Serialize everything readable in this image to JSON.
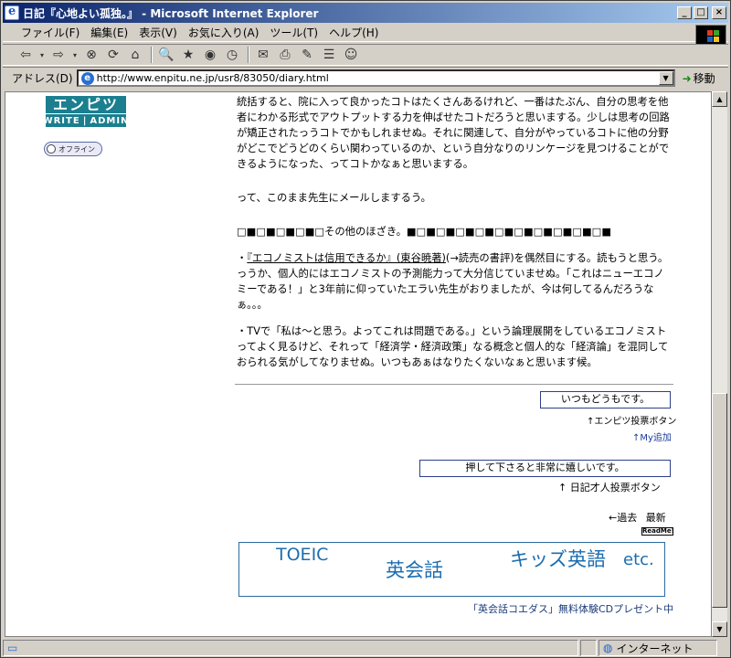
{
  "window": {
    "title": "日記『心地よい孤独。』 - Microsoft Internet Explorer",
    "controls": {
      "minimize": "_",
      "maximize": "□",
      "close": "×"
    }
  },
  "menu": [
    "ファイル(F)",
    "編集(E)",
    "表示(V)",
    "お気に入り(A)",
    "ツール(T)",
    "ヘルプ(H)"
  ],
  "toolbar": {
    "buttons": [
      {
        "icon": "back-icon",
        "glyph": "⇦"
      },
      {
        "icon": "dropdown-icon",
        "glyph": "▾"
      },
      {
        "icon": "forward-icon",
        "glyph": "⇨"
      },
      {
        "icon": "dropdown-icon",
        "glyph": "▾"
      },
      {
        "icon": "stop-icon",
        "glyph": "⊗"
      },
      {
        "icon": "refresh-icon",
        "glyph": "⟳"
      },
      {
        "icon": "home-icon",
        "glyph": "⌂"
      },
      {
        "icon": "search-icon",
        "glyph": "🔍"
      },
      {
        "icon": "favorites-icon",
        "glyph": "★"
      },
      {
        "icon": "media-icon",
        "glyph": "◉"
      },
      {
        "icon": "history-icon",
        "glyph": "◷"
      },
      {
        "icon": "mail-icon",
        "glyph": "✉"
      },
      {
        "icon": "print-icon",
        "glyph": "⎙"
      },
      {
        "icon": "edit-icon",
        "glyph": "✎"
      },
      {
        "icon": "discuss-icon",
        "glyph": "☰"
      },
      {
        "icon": "messenger-icon",
        "glyph": "☺"
      }
    ]
  },
  "address": {
    "label": "アドレス(D)",
    "url": "http://www.enpitu.ne.jp/usr8/83050/diary.html",
    "go_label": "移動"
  },
  "sidebar": {
    "logo_top": "エンピツ",
    "logo_write": "WRITE",
    "logo_sep": "|",
    "logo_admin": "ADMIN",
    "offline_label": "オフライン"
  },
  "article": {
    "para1": "統括すると、院に入って良かったコトはたくさんあるけれど、一番はたぶん、自分の思考を他者にわかる形式でアウトプットする力を伸ばせたコトだろうと思いまする。少しは思考の回路が矯正されたっうコトでかもしれませぬ。それに関連して、自分がやっているコトに他の分野がどこでどうどのくらい関わっているのか、という自分なりのリンケージを見つけることができるようになった、ってコトかなぁと思いまする。",
    "para2": "って、このまま先生にメールしまするう。",
    "para3": "□■□■□■□■□その他のほざき。■□■□■□■□■□■□■□■□■□■□■",
    "para4_prefix": "・",
    "para4_link": "『エコノミストは信用できるか』(東谷暁著)",
    "para4_rest": "(→読売の書評)を偶然目にする。読もうと思う。っうか、個人的にはエコノミストの予測能力って大分信じていませぬ。「これはニューエコノミーである！」と3年前に仰っていたエラい先生がおりましたが、今は何してるんだろうなぁ。。。",
    "para5": "・TVで「私は～と思う。よってこれは問題である。」という論理展開をしているエコノミストってよく見るけど、それって「経済学・経済政策」なる概念と個人的な「経済論」を混同しておられる気がしてなりませぬ。いつもあぁはなりたくないなぁと思います候。"
  },
  "votes": {
    "enpitu_button": "いつもどうもです。",
    "enpitu_caption": "↑エンピツ投票ボタン",
    "my_add": "↑My追加",
    "nikki_button": "押して下さると非常に嬉しいです。",
    "nikki_caption": "↑ 日記才人投票ボタン"
  },
  "nav": {
    "past": "←過去",
    "latest": "最新",
    "readme": "ReadMe!"
  },
  "banner": {
    "t1": "TOEIC",
    "t2": "英会話",
    "t3": "キッズ英語",
    "t4": "etc."
  },
  "promo": "「英会話コエダス」無料体験CDプレゼント中",
  "status": {
    "zone": "インターネット"
  }
}
